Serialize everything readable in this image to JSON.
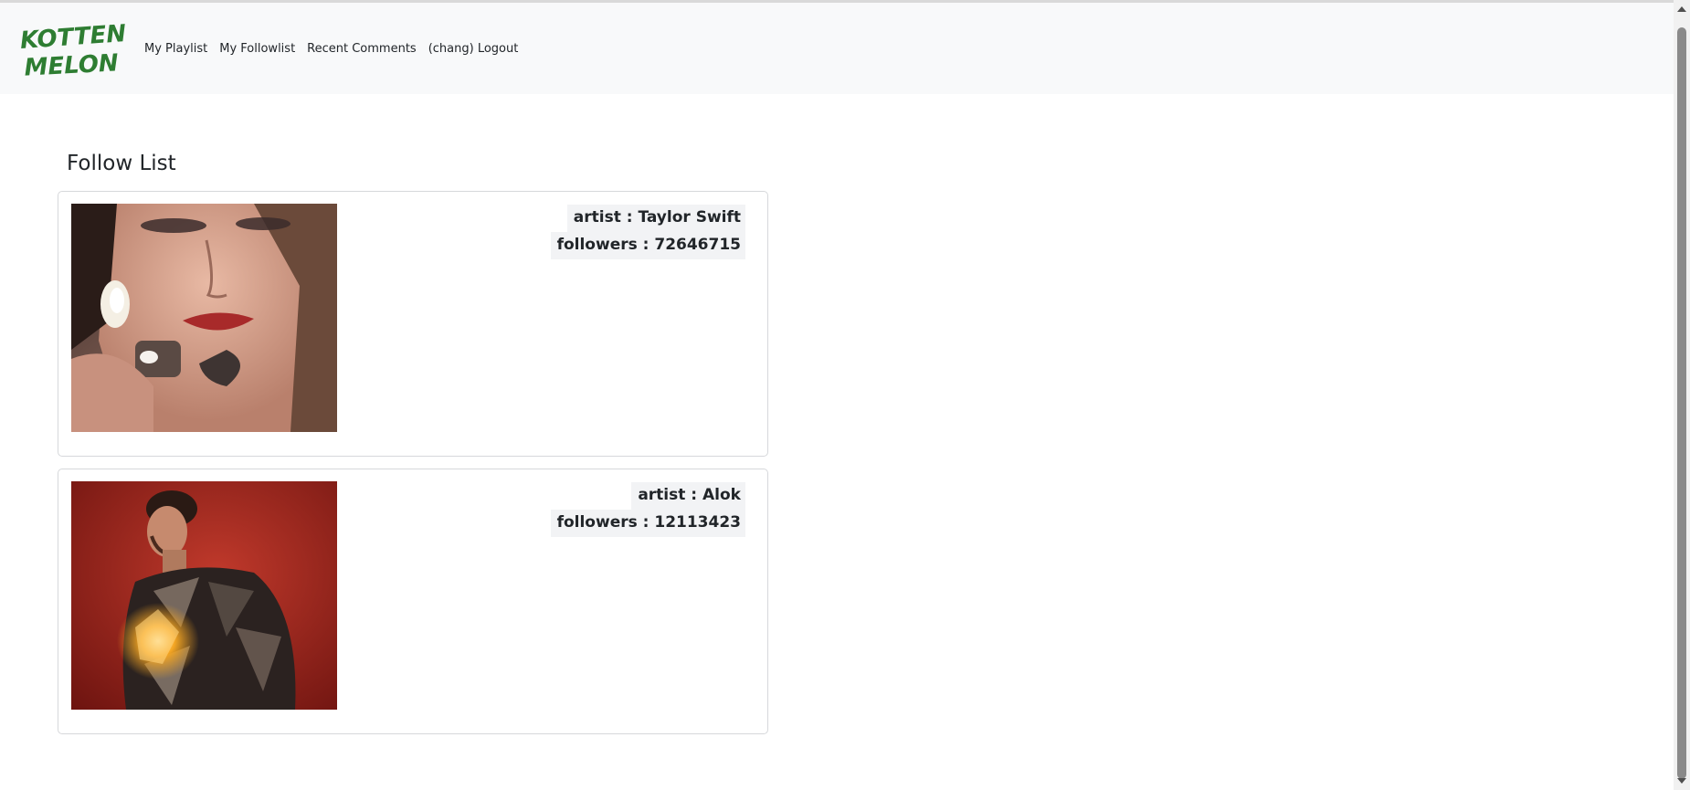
{
  "brand": {
    "line1": "KOTTEN",
    "line2": "MELON",
    "color": "#2e7d32"
  },
  "nav": {
    "playlist": "My Playlist",
    "followlist": "My Followlist",
    "comments": "Recent Comments",
    "logout": "(chang) Logout"
  },
  "page": {
    "title": "Follow List"
  },
  "artists": [
    {
      "artist_line": "artist : Taylor Swift",
      "followers_line": "followers : 72646715"
    },
    {
      "artist_line": "artist : Alok",
      "followers_line": "followers : 12113423"
    }
  ],
  "colors": {
    "navbar_bg": "#f8f9fa",
    "card_border": "#d6d8db",
    "label_bg": "#f2f3f5"
  }
}
